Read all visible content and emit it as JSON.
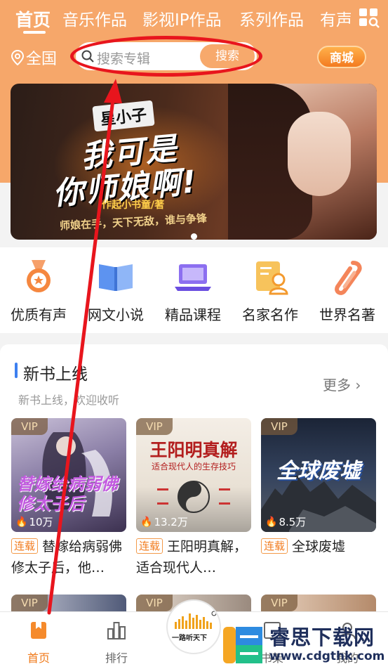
{
  "top_tabs": [
    "首页",
    "音乐作品",
    "影视IP作品",
    "系列作品",
    "有声"
  ],
  "location": "全国",
  "search": {
    "placeholder": "搜索专辑",
    "button": "搜索"
  },
  "mall": "商城",
  "banner": {
    "tag": "星小子",
    "title_line1": "我可是",
    "title_line2": "你师娘啊!",
    "author": "作起小书童/著",
    "tagline": "师娘在手，天下无敌，谁与争锋"
  },
  "categories": [
    {
      "label": "优质有声",
      "icon": "medal-icon"
    },
    {
      "label": "网文小说",
      "icon": "book-icon"
    },
    {
      "label": "精品课程",
      "icon": "laptop-icon"
    },
    {
      "label": "名家名作",
      "icon": "author-card-icon"
    },
    {
      "label": "世界名著",
      "icon": "paperclip-icon"
    }
  ],
  "section": {
    "title": "新书上线",
    "more": "更多",
    "subtitle": "新书上线，欢迎收听"
  },
  "books": [
    {
      "vip": "VIP",
      "plays": "10万",
      "badge": "连载",
      "title": "替嫁给病弱佛修太子后，他…",
      "cover_text": "替嫁给病弱佛修太子后"
    },
    {
      "vip": "VIP",
      "plays": "13.2万",
      "badge": "连载",
      "title": "王阳明真解，适合现代人…",
      "cover_text": "王阳明真解",
      "cover_sub": "适合现代人的生存技巧"
    },
    {
      "vip": "VIP",
      "plays": "8.5万",
      "badge": "连载",
      "title": "全球废墟",
      "cover_text": "全球废墟"
    }
  ],
  "row2_vip": [
    "VIP",
    "VIP",
    "VIP"
  ],
  "tabbar": [
    {
      "label": "首页",
      "icon": "home-icon",
      "active": true
    },
    {
      "label": "排行",
      "icon": "ranking-icon"
    },
    {
      "label": "书架",
      "icon": "shelf-icon"
    },
    {
      "label": "我的",
      "icon": "profile-icon"
    }
  ],
  "center_logo": "一路听天下",
  "watermark": {
    "text": "睿思下载网",
    "url": "www.cdgthk.com"
  },
  "colors": {
    "header": "#f6a76a",
    "accent": "#f07a1a",
    "annotation": "#e8151d"
  }
}
